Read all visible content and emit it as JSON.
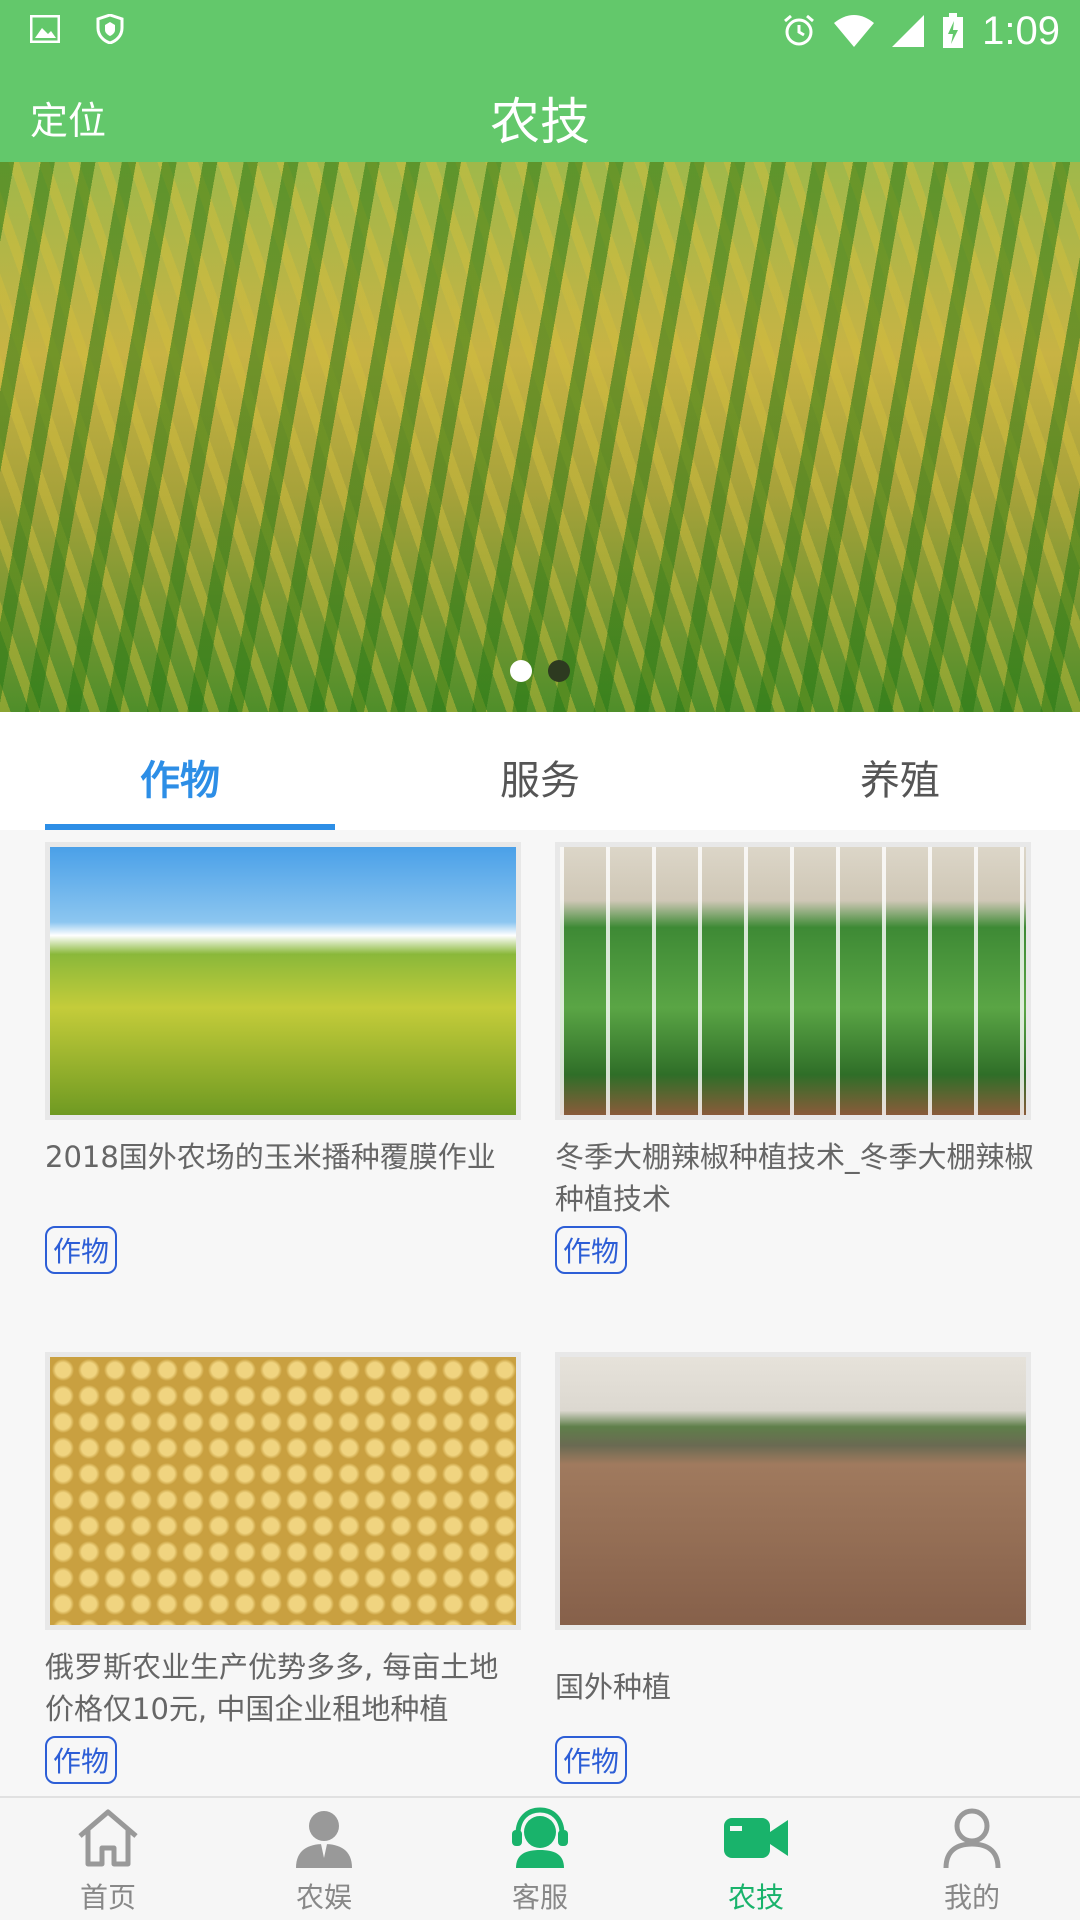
{
  "status_bar": {
    "time": "1:09"
  },
  "appbar": {
    "locate_label": "定位",
    "title": "农技"
  },
  "banner": {
    "dot_count": 2,
    "active_index": 0
  },
  "tabs": [
    {
      "label": "作物",
      "active": true
    },
    {
      "label": "服务",
      "active": false
    },
    {
      "label": "养殖",
      "active": false
    }
  ],
  "cards": [
    {
      "title": "2018国外农场的玉米播种覆膜作业",
      "tag": "作物",
      "image": "cornfield"
    },
    {
      "title": "冬季大棚辣椒种植技术_冬季大棚辣椒种植技术",
      "tag": "作物",
      "image": "greenhouse-peppers"
    },
    {
      "title": "俄罗斯农业生产优势多多, 每亩土地价格仅10元, 中国企业租地种植",
      "tag": "作物",
      "image": "soybeans"
    },
    {
      "title": "国外种植",
      "tag": "作物",
      "image": "plowed-field"
    }
  ],
  "bottom_nav": [
    {
      "label": "首页",
      "icon": "home-icon",
      "active": false
    },
    {
      "label": "农娱",
      "icon": "user-icon",
      "active": false
    },
    {
      "label": "客服",
      "icon": "headset-icon",
      "active": false
    },
    {
      "label": "农技",
      "icon": "video-camera-icon",
      "active": true
    },
    {
      "label": "我的",
      "icon": "person-icon",
      "active": false
    }
  ],
  "colors": {
    "primary_green": "#63c86b",
    "tab_blue": "#2d8ee6",
    "nav_active": "#19b36b",
    "tag_blue": "#2d5ed6"
  }
}
